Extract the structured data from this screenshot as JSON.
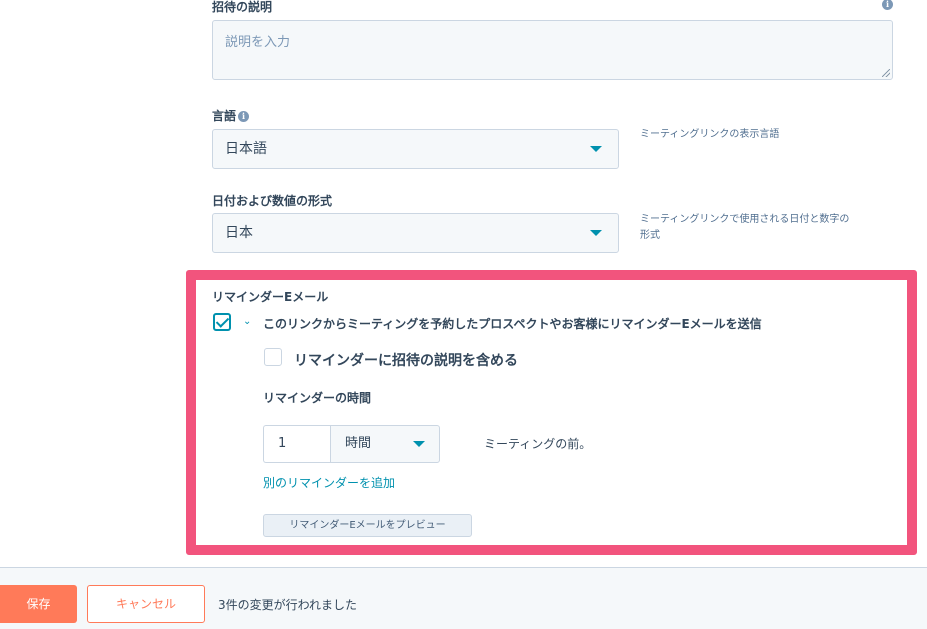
{
  "invite_description": {
    "label": "招待の説明",
    "placeholder": "説明を入力"
  },
  "language": {
    "label": "言語",
    "value": "日本語",
    "help": "ミーティングリンクの表示言語"
  },
  "date_format": {
    "label": "日付および数値の形式",
    "value": "日本",
    "help_line1": "ミーティングリンクで使用される日付と数字の",
    "help_line2": "形式"
  },
  "reminder": {
    "section_label": "リマインダーEメール",
    "send_checkbox_label": "このリンクからミーティングを予約したプロスペクトやお客様にリマインダーEメールを送信",
    "send_checked": true,
    "include_desc_label": "リマインダーに招待の説明を含める",
    "include_desc_checked": false,
    "timing_label": "リマインダーの時間",
    "amount": "1",
    "unit": "時間",
    "before_text": "ミーティングの前。",
    "add_link": "別のリマインダーを追加",
    "preview_button": "リマインダーEメールをプレビュー"
  },
  "footer": {
    "save": "保存",
    "cancel": "キャンセル",
    "changes": "3件の変更が行われました"
  },
  "colors": {
    "highlight": "#f2547d",
    "accent": "#0091ae",
    "primary_button": "#ff7a59"
  }
}
